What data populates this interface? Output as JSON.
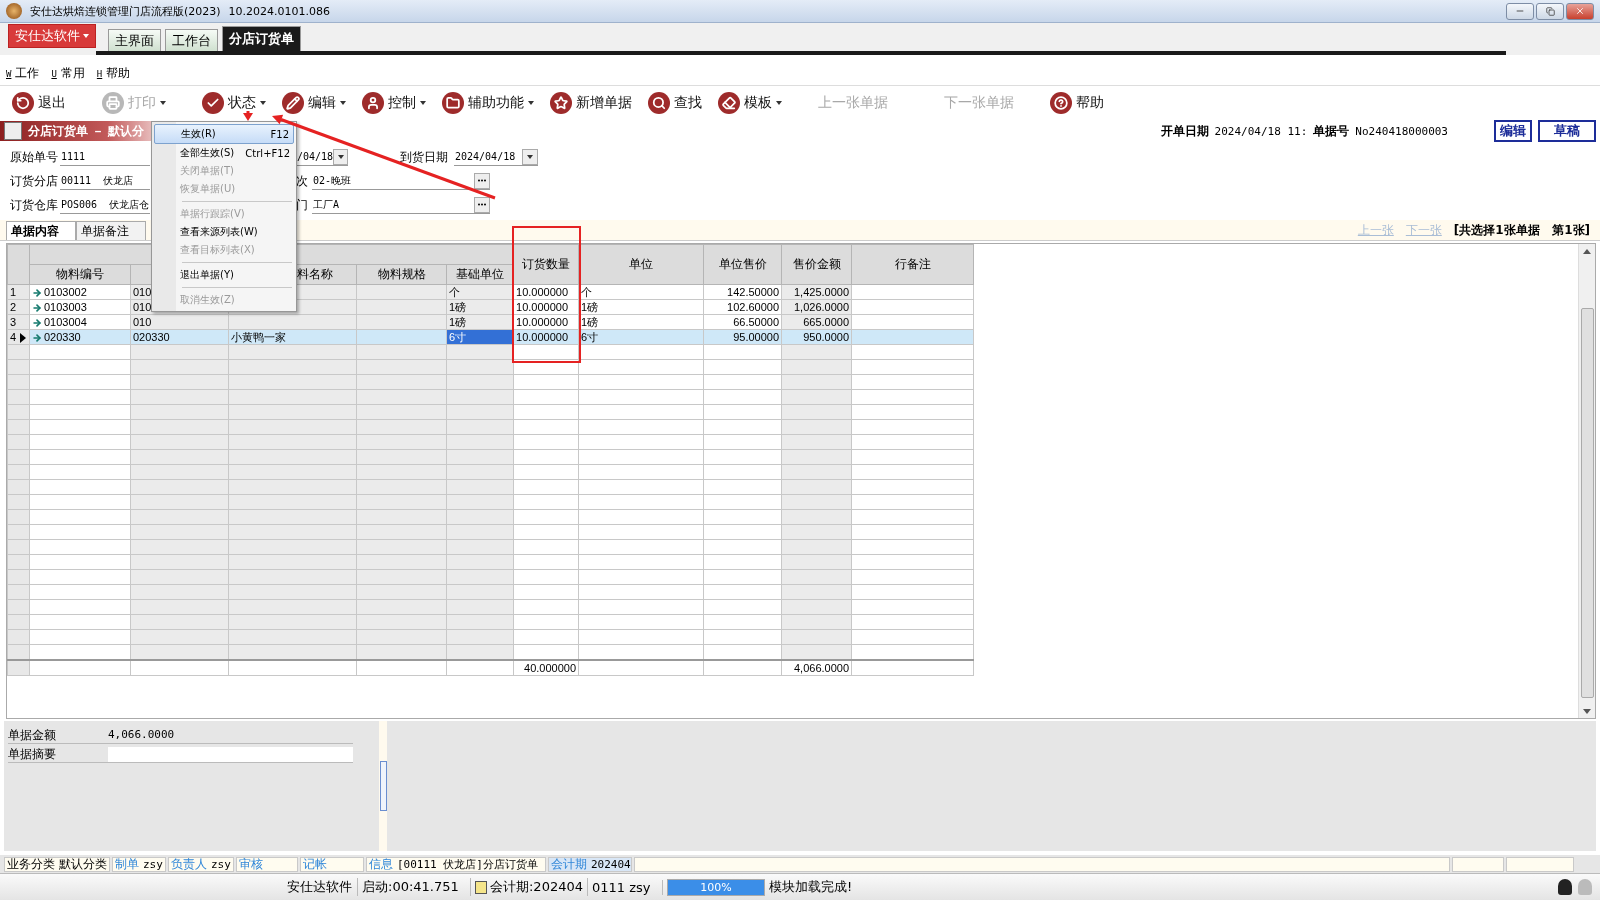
{
  "window": {
    "title": "安仕达烘焙连锁管理门店流程版(2023)",
    "version": "10.2024.0101.086"
  },
  "app_menu": {
    "label": "安仕达软件"
  },
  "tabs": [
    {
      "label": "主界面",
      "selected": false
    },
    {
      "label": "工作台",
      "selected": false
    },
    {
      "label": "分店订货单",
      "selected": true
    }
  ],
  "menu_bar": [
    {
      "key": "W",
      "label": "工作"
    },
    {
      "key": "U",
      "label": "常用"
    },
    {
      "key": "H",
      "label": "帮助"
    }
  ],
  "toolbar": [
    {
      "label": "退出",
      "disabled": false,
      "dropdown": false
    },
    {
      "label": "打印",
      "disabled": true,
      "dropdown": true
    },
    {
      "label": "状态",
      "disabled": false,
      "dropdown": true
    },
    {
      "label": "编辑",
      "disabled": false,
      "dropdown": true
    },
    {
      "label": "控制",
      "disabled": false,
      "dropdown": true
    },
    {
      "label": "辅助功能",
      "disabled": false,
      "dropdown": true
    },
    {
      "label": "新增单据",
      "disabled": false,
      "dropdown": false
    },
    {
      "label": "查找",
      "disabled": false,
      "dropdown": false
    },
    {
      "label": "模板",
      "disabled": false,
      "dropdown": true
    },
    {
      "label": "上一张单据",
      "disabled": true,
      "dropdown": false
    },
    {
      "label": "下一张单据",
      "disabled": true,
      "dropdown": false
    },
    {
      "label": "帮助",
      "disabled": false,
      "dropdown": false
    }
  ],
  "document": {
    "title": "分店订货单 － 默认分",
    "open_date_label": "开单日期",
    "open_date": "2024/04/18 11:",
    "number_label": "单据号",
    "number": "No240418000003",
    "badges": [
      "编辑",
      "草稿"
    ]
  },
  "form": [
    [
      {
        "kind": "text",
        "label": "原始单号",
        "value": "1111"
      },
      {
        "kind": "date",
        "value": "/04/18"
      },
      {
        "kind": "date",
        "label": "到货日期",
        "value": "2024/04/18"
      }
    ],
    [
      {
        "kind": "text",
        "label": "订货分店",
        "value": "00111  伏龙店"
      },
      {
        "kind": "lookup",
        "label": "次",
        "value": "02-晚班"
      }
    ],
    [
      {
        "kind": "text",
        "label": "订货仓库",
        "value": "POS006  伏龙店仓"
      },
      {
        "kind": "lookup",
        "label": "门",
        "value": "工厂A"
      }
    ]
  ],
  "doc_tabs": [
    {
      "label": "单据内容",
      "selected": true
    },
    {
      "label": "单据备注",
      "selected": false
    }
  ],
  "pager": {
    "prev": "上一张",
    "next": "下一张",
    "summary": "[共选择1张单据   第1张]"
  },
  "table": {
    "columns": [
      "物料编号",
      null,
      "料名称",
      "物料规格",
      "基础单位",
      "订货数量",
      "单位",
      "单位售价",
      "售价金额",
      "行备注"
    ],
    "rows": [
      {
        "num": "1",
        "code": "0103002",
        "code_2": "010",
        "name": "",
        "spec": "",
        "base_unit": "个",
        "qty": "10.000000",
        "unit": "个",
        "price": "142.50000",
        "amount": "1,425.0000",
        "note": "",
        "selected": false
      },
      {
        "num": "2",
        "code": "0103003",
        "code_2": "010",
        "name": "",
        "spec": "",
        "base_unit": "1磅",
        "qty": "10.000000",
        "unit": "1磅",
        "price": "102.60000",
        "amount": "1,026.0000",
        "note": "",
        "selected": false
      },
      {
        "num": "3",
        "code": "0103004",
        "code_2": "010",
        "name": "",
        "spec": "",
        "base_unit": "1磅",
        "qty": "10.000000",
        "unit": "1磅",
        "price": "66.50000",
        "amount": "665.0000",
        "note": "",
        "selected": false
      },
      {
        "num": "4",
        "code": "020330",
        "code_2": "020330",
        "name": "小黄鸭一家",
        "spec": "",
        "base_unit": "6寸",
        "qty": "10.000000",
        "unit": "6寸",
        "price": "95.00000",
        "amount": "950.0000",
        "note": "",
        "selected": true
      }
    ],
    "totals": {
      "qty": "40.000000",
      "amount": "4,066.0000"
    }
  },
  "context_menu": [
    {
      "kind": "item",
      "label": "生效(R)",
      "shortcut": "F12",
      "selected": true,
      "disabled": false
    },
    {
      "kind": "item",
      "label": "全部生效(S)",
      "shortcut": "Ctrl+F12",
      "selected": false,
      "disabled": false
    },
    {
      "kind": "item",
      "label": "关闭单据(T)",
      "selected": false,
      "disabled": true
    },
    {
      "kind": "item",
      "label": "恢复单据(U)",
      "selected": false,
      "disabled": true
    },
    {
      "kind": "separator"
    },
    {
      "kind": "item",
      "label": "单据行跟踪(V)",
      "selected": false,
      "disabled": true
    },
    {
      "kind": "item",
      "label": "查看来源列表(W)",
      "selected": false,
      "disabled": false
    },
    {
      "kind": "item",
      "label": "查看目标列表(X)",
      "selected": false,
      "disabled": true
    },
    {
      "kind": "separator"
    },
    {
      "kind": "item",
      "label": "退出单据(Y)",
      "selected": false,
      "disabled": false
    },
    {
      "kind": "separator"
    },
    {
      "kind": "item",
      "label": "取消生效(Z)",
      "selected": false,
      "disabled": true
    }
  ],
  "summary": [
    {
      "kind": "readonly",
      "label": "单据金额",
      "value": "4,066.0000"
    },
    {
      "kind": "input",
      "label": "单据摘要"
    }
  ],
  "status_strip": [
    {
      "kind": "plain",
      "label": "业务分类",
      "value": "默认分类"
    },
    {
      "kind": "link",
      "label": "制单",
      "value": "zsy"
    },
    {
      "kind": "link",
      "label": "负责人",
      "value": "zsy"
    },
    {
      "kind": "link",
      "label": "审核"
    },
    {
      "kind": "link",
      "label": "记帐"
    },
    {
      "kind": "link",
      "label": "信息",
      "value": "[00111 伏龙店]分店订货单"
    },
    {
      "kind": "highlight",
      "label": "会计期",
      "value": "202404"
    }
  ],
  "status_bar": {
    "company": "安仕达软件",
    "uptime": "启动:00:41.751",
    "period": "会计期:202404",
    "user": "0111 zsy",
    "progress": {
      "level": 1,
      "text": "100%"
    },
    "message": "模块加载完成!"
  }
}
